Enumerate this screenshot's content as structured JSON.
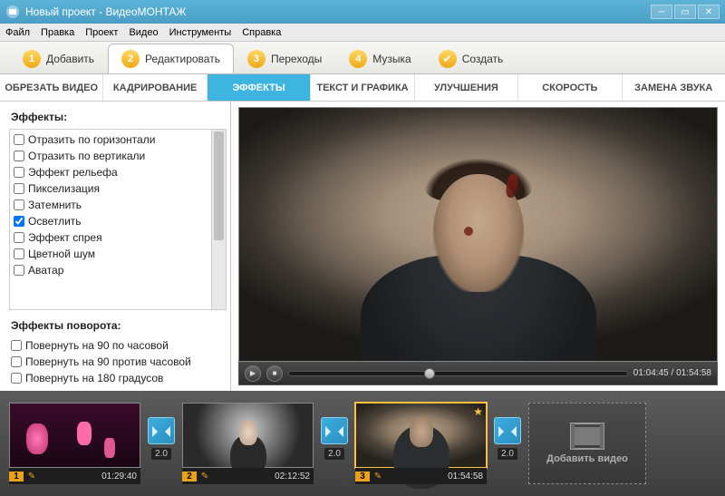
{
  "window": {
    "title": "Новый проект - ВидеоМОНТАЖ"
  },
  "menu": {
    "items": [
      "Файл",
      "Правка",
      "Проект",
      "Видео",
      "Инструменты",
      "Справка"
    ]
  },
  "steps": {
    "items": [
      {
        "num": "1",
        "label": "Добавить"
      },
      {
        "num": "2",
        "label": "Редактировать"
      },
      {
        "num": "3",
        "label": "Переходы"
      },
      {
        "num": "4",
        "label": "Музыка"
      }
    ],
    "create_label": "Создать",
    "active": 1
  },
  "subtabs": {
    "items": [
      "ОБРЕЗАТЬ ВИДЕО",
      "КАДРИРОВАНИЕ",
      "ЭФФЕКТЫ",
      "ТЕКСТ И ГРАФИКА",
      "УЛУЧШЕНИЯ",
      "СКОРОСТЬ",
      "ЗАМЕНА ЗВУКА"
    ],
    "active": 2
  },
  "effects": {
    "title": "Эффекты:",
    "items": [
      {
        "label": "Отразить по горизонтали",
        "checked": false
      },
      {
        "label": "Отразить по вертикали",
        "checked": false
      },
      {
        "label": "Эффект рельефа",
        "checked": false
      },
      {
        "label": "Пикселизация",
        "checked": false
      },
      {
        "label": "Затемнить",
        "checked": false
      },
      {
        "label": "Осветлить",
        "checked": true
      },
      {
        "label": "Эффект спрея",
        "checked": false
      },
      {
        "label": "Цветной шум",
        "checked": false
      },
      {
        "label": "Аватар",
        "checked": false
      }
    ],
    "rotation_title": "Эффекты поворота:",
    "rotation_items": [
      {
        "label": "Повернуть на 90 по часовой",
        "checked": false
      },
      {
        "label": "Повернуть на 90 против часовой",
        "checked": false
      },
      {
        "label": "Повернуть на 180 градусов",
        "checked": false
      }
    ]
  },
  "player": {
    "current": "01:04:45",
    "total": "01:54:58"
  },
  "timeline": {
    "clips": [
      {
        "index": "1",
        "duration": "01:29:40",
        "selected": false
      },
      {
        "index": "2",
        "duration": "02:12:52",
        "selected": false
      },
      {
        "index": "3",
        "duration": "01:54:58",
        "selected": true
      }
    ],
    "transition_sec": "2.0",
    "add_label": "Добавить видео"
  }
}
